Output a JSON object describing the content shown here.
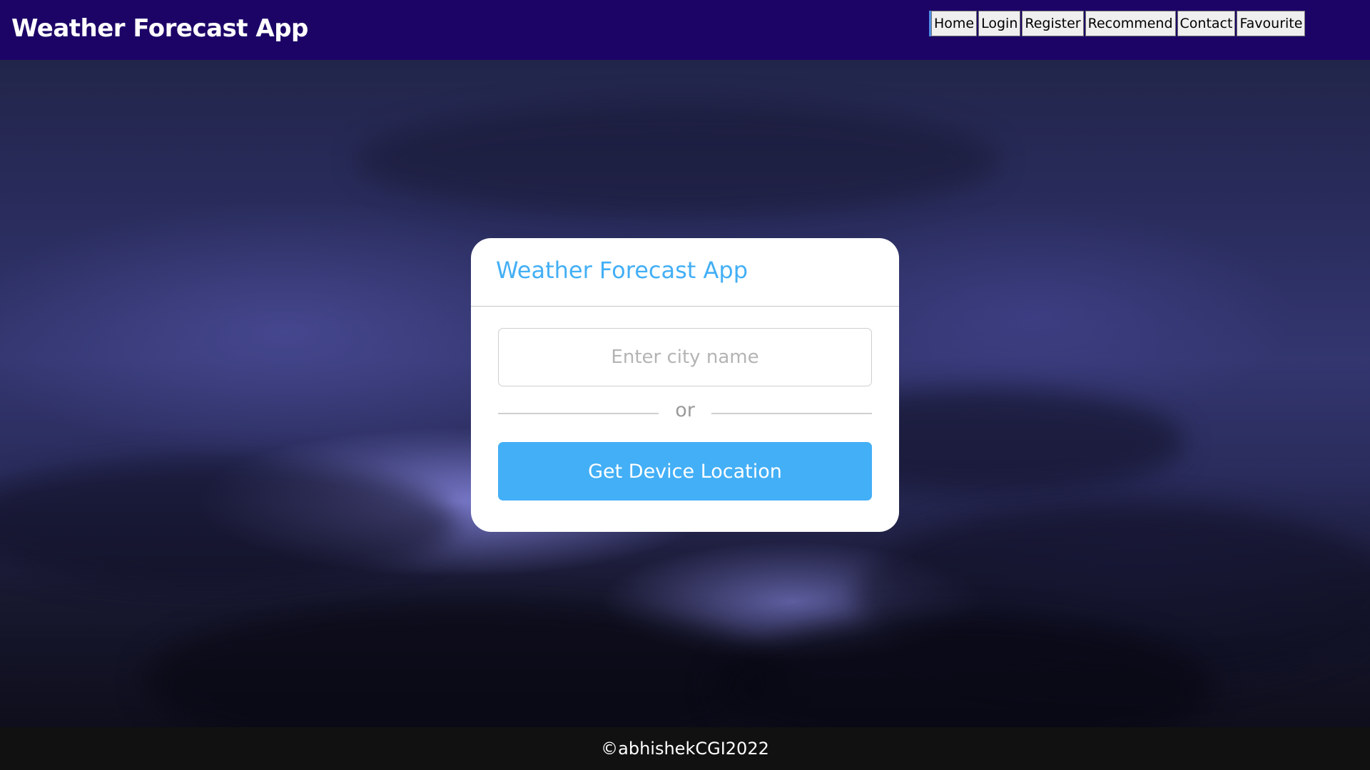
{
  "header": {
    "brand": "Weather Forecast App",
    "nav": [
      {
        "label": "Home"
      },
      {
        "label": "Login"
      },
      {
        "label": "Register"
      },
      {
        "label": "Recommend"
      },
      {
        "label": "Contact"
      },
      {
        "label": "Favourite"
      }
    ]
  },
  "card": {
    "title": "Weather Forecast App",
    "city_input": {
      "value": "",
      "placeholder": "Enter city name"
    },
    "or_text": "or",
    "location_button": "Get Device Location"
  },
  "footer": {
    "text": "©abhishekCGI2022"
  },
  "colors": {
    "header_bg": "#1c0467",
    "accent": "#43aff6",
    "footer_bg": "#111111"
  },
  "background": {
    "description_icon": "stormy-night-sky-lightning-image"
  }
}
